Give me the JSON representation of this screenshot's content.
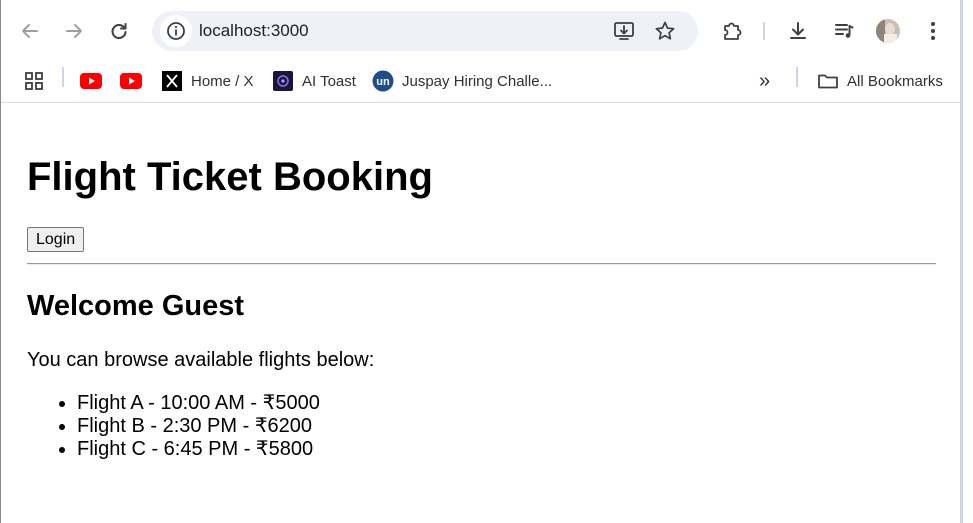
{
  "browser": {
    "url": "localhost:3000",
    "accent": "#eef2f8"
  },
  "bookmarks": {
    "items": [
      {
        "label": "",
        "icon": "youtube-icon"
      },
      {
        "label": "",
        "icon": "youtube-icon"
      },
      {
        "label": "Home / X",
        "icon": "x-logo-icon"
      },
      {
        "label": "AI Toast",
        "icon": "ai-toast-icon"
      },
      {
        "label": "Juspay Hiring Challe...",
        "icon": "unstop-icon"
      }
    ],
    "overflow_label": "»",
    "all_bookmarks_label": "All Bookmarks"
  },
  "page": {
    "title": "Flight Ticket Booking",
    "login_label": "Login",
    "welcome": "Welcome Guest",
    "intro": "You can browse available flights below:",
    "flights": [
      "Flight A - 10:00 AM - ₹5000",
      "Flight B - 2:30 PM - ₹6200",
      "Flight C - 6:45 PM - ₹5800"
    ]
  }
}
